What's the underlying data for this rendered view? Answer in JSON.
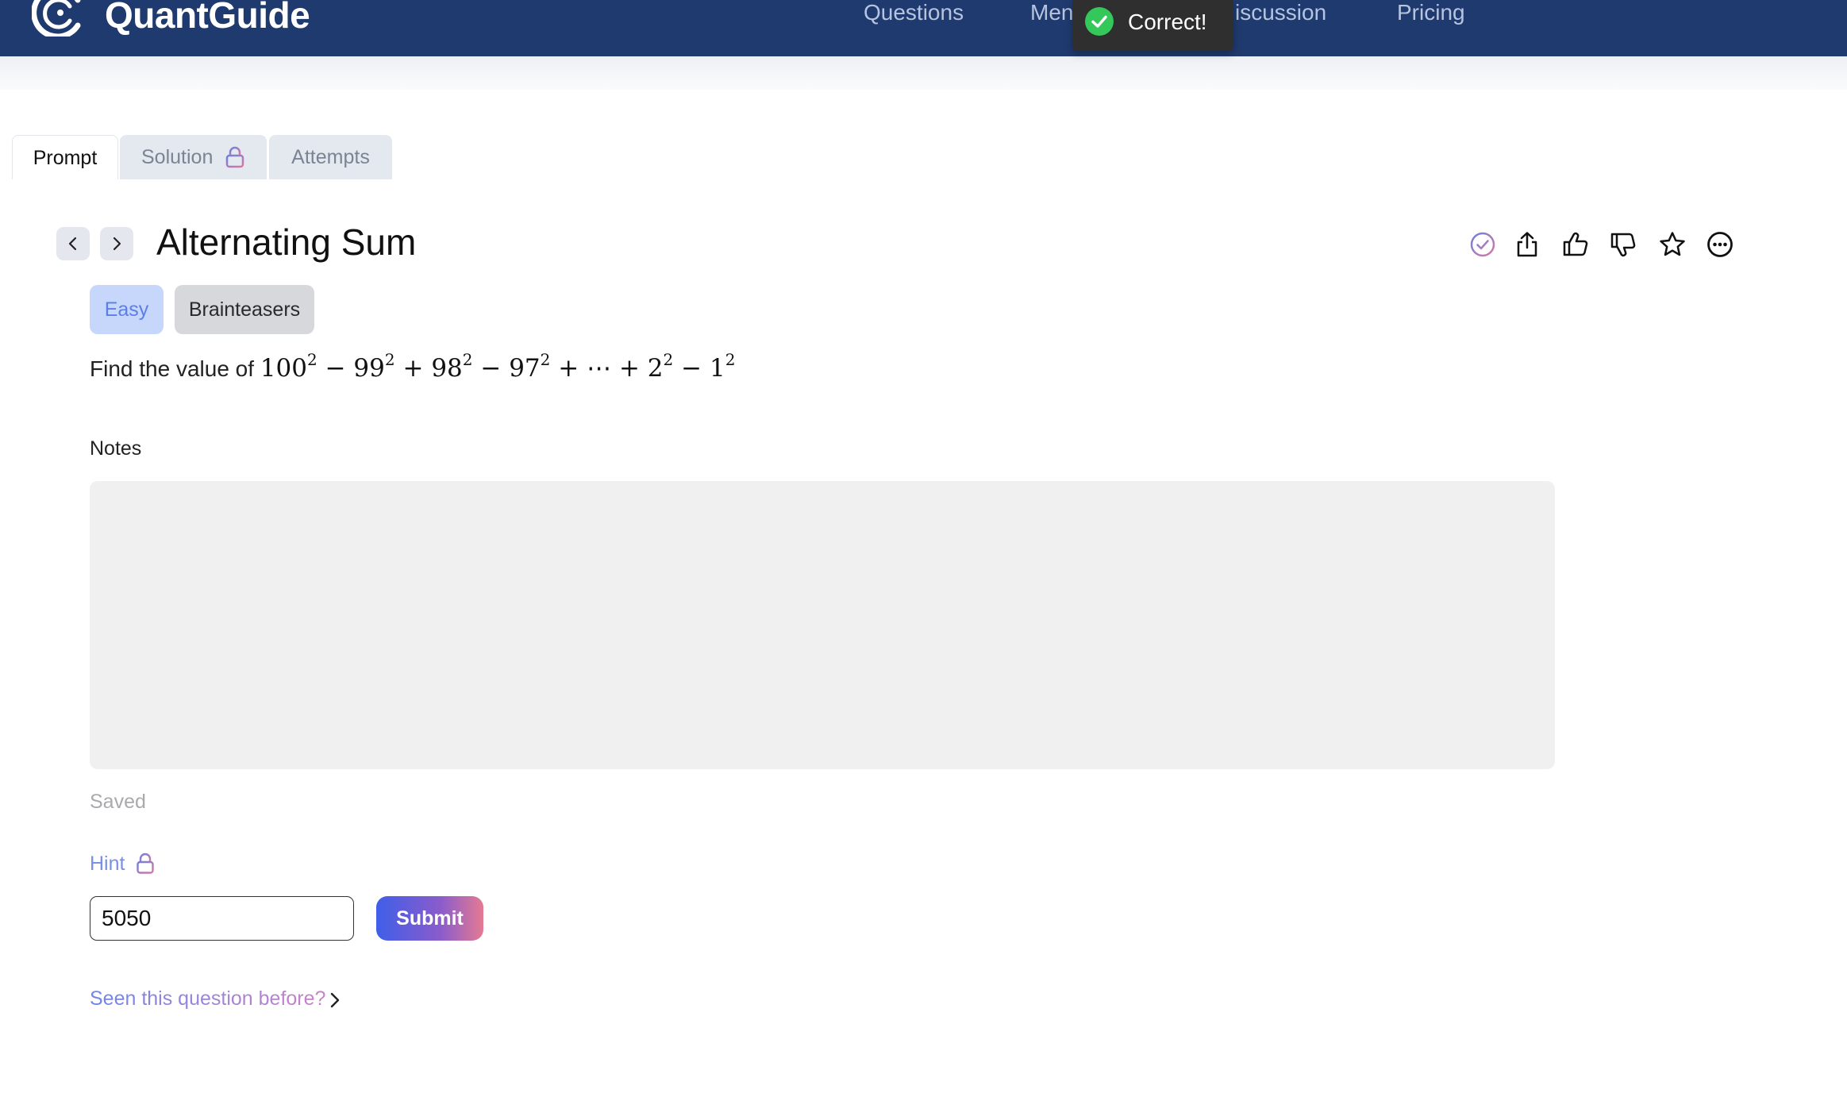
{
  "header": {
    "brand": "QuantGuide",
    "nav": {
      "questions": "Questions",
      "mentors_partial": "Men",
      "discussion_partial": "iscussion",
      "pricing": "Pricing"
    }
  },
  "toast": {
    "message": "Correct!",
    "icon": "check-circle-icon",
    "color": "#34c759"
  },
  "tabs": {
    "prompt": "Prompt",
    "solution": "Solution",
    "attempts": "Attempts"
  },
  "question": {
    "title": "Alternating Sum",
    "difficulty": "Easy",
    "category": "Brainteasers",
    "prompt_prefix": "Find the value of",
    "expression": {
      "t1": "100",
      "op1": "−",
      "t2": "99",
      "op2": "+",
      "t3": "98",
      "op3": "−",
      "t4": "97",
      "op4": "+",
      "dots": "⋯",
      "op5": "+",
      "t5": "2",
      "op6": "−",
      "t6": "1",
      "exponent": "2"
    }
  },
  "actions": [
    "check-circle-icon",
    "share-icon",
    "thumbs-up-icon",
    "thumbs-down-icon",
    "star-icon",
    "more-icon"
  ],
  "notes": {
    "label": "Notes",
    "status": "Saved"
  },
  "hint": {
    "label": "Hint"
  },
  "answer": {
    "value": "5050",
    "submit_label": "Submit"
  },
  "seen_before": {
    "label": "Seen this question before?"
  },
  "colors": {
    "nav_bg": "#1f3a6e",
    "accent": "#5a7fe6",
    "success": "#34c759"
  }
}
